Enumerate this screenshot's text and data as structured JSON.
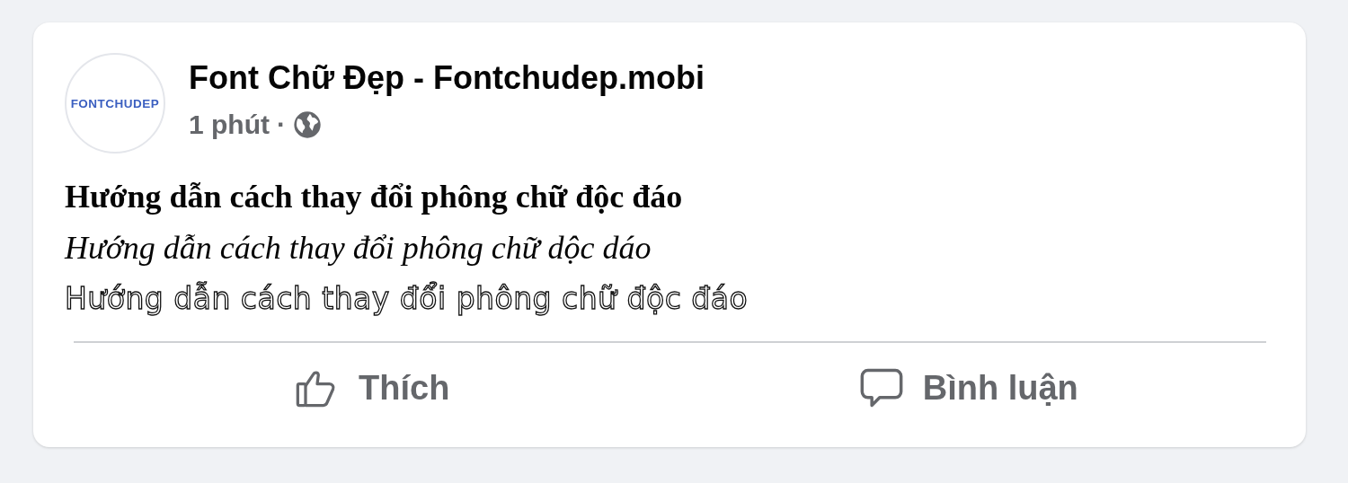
{
  "post": {
    "author": "Font Chữ Đẹp - Fontchudep.mobi",
    "avatar_text": "FONTCHUDEP",
    "time": "1 phút",
    "separator": "·",
    "lines": [
      {
        "kind": "bold",
        "text": "Hướng dẫn cách thay đổi phông chữ độc đáo"
      },
      {
        "kind": "italic",
        "text": "Hướng dẫn cách thay đổi phông chữ dộc dáo"
      },
      {
        "kind": "outline",
        "text": "Hướng dẫn cách thay đổi phông chữ độc đáo"
      }
    ],
    "actions": [
      {
        "kind": "like",
        "label": "Thích"
      },
      {
        "kind": "comment",
        "label": "Bình luận"
      }
    ]
  }
}
